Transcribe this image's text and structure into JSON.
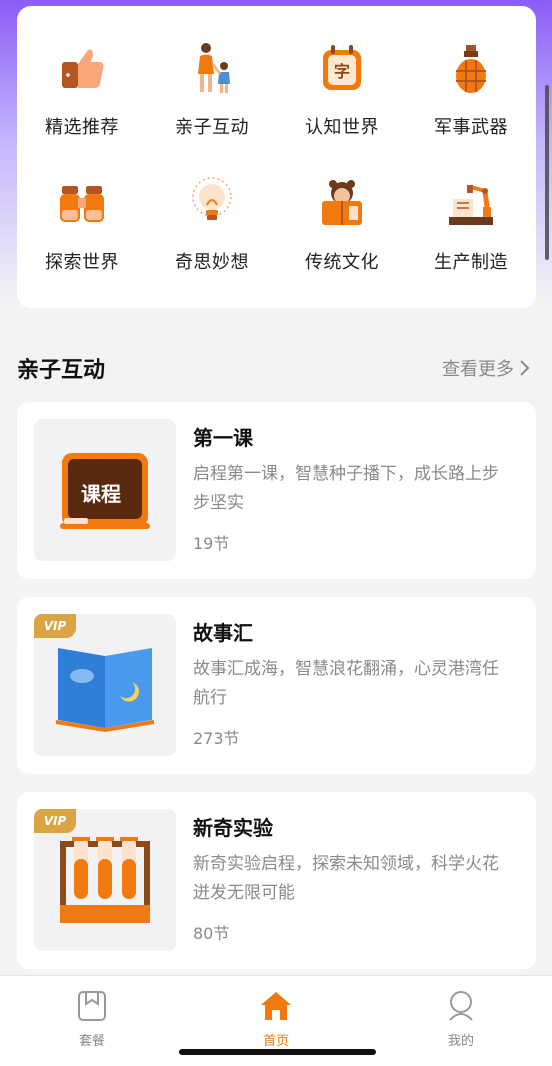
{
  "categories": [
    {
      "label": "精选推荐",
      "icon": "thumbs-up-icon"
    },
    {
      "label": "亲子互动",
      "icon": "parent-child-icon"
    },
    {
      "label": "认知世界",
      "icon": "character-card-icon"
    },
    {
      "label": "军事武器",
      "icon": "grenade-icon"
    },
    {
      "label": "探索世界",
      "icon": "binoculars-icon"
    },
    {
      "label": "奇思妙想",
      "icon": "lightbulb-icon"
    },
    {
      "label": "传统文化",
      "icon": "book-character-icon"
    },
    {
      "label": "生产制造",
      "icon": "robot-arm-icon"
    }
  ],
  "section": {
    "title": "亲子互动",
    "more": "查看更多"
  },
  "courses": [
    {
      "title": "第一课",
      "desc": "启程第一课，智慧种子播下，成长路上步步坚实",
      "count": "19节",
      "vip": false,
      "thumb_text": "课程"
    },
    {
      "title": "故事汇",
      "desc": "故事汇成海，智慧浪花翻涌，心灵港湾任航行",
      "count": "273节",
      "vip": true,
      "vip_label": "VIP"
    },
    {
      "title": "新奇实验",
      "desc": "新奇实验启程，探索未知领域，科学火花迸发无限可能",
      "count": "80节",
      "vip": true,
      "vip_label": "VIP"
    }
  ],
  "tabs": [
    {
      "label": "套餐",
      "icon": "package-icon",
      "active": false
    },
    {
      "label": "首页",
      "icon": "home-icon",
      "active": true
    },
    {
      "label": "我的",
      "icon": "profile-icon",
      "active": false
    }
  ],
  "colors": {
    "accent": "#f07a10",
    "vip": "#d9a441"
  }
}
